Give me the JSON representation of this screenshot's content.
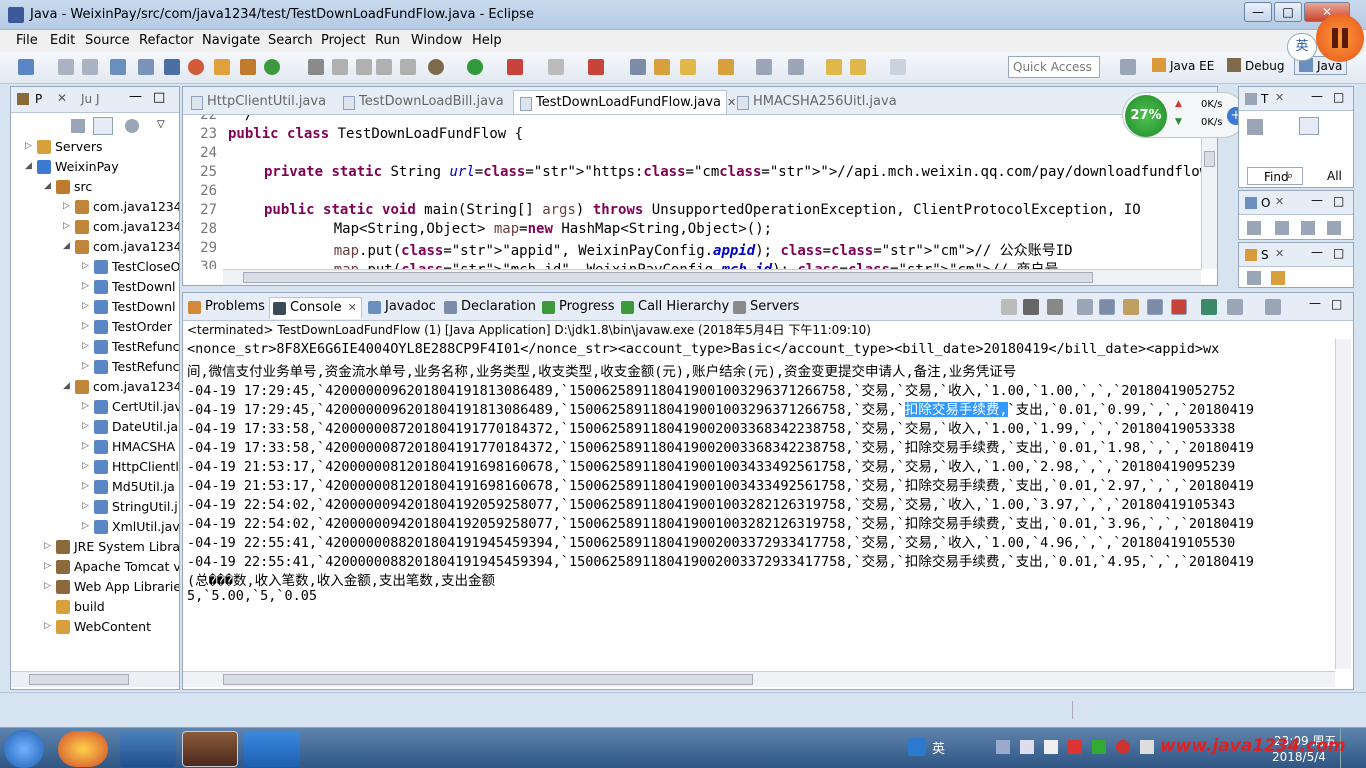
{
  "window": {
    "title": "Java - WeixinPay/src/com/java1234/test/TestDownLoadFundFlow.java - Eclipse",
    "minimize": "—",
    "maximize": "□",
    "close": "✕"
  },
  "menu": [
    "File",
    "Edit",
    "Source",
    "Refactor",
    "Navigate",
    "Search",
    "Project",
    "Run",
    "Window",
    "Help"
  ],
  "toolbar": {
    "quick_access": "Quick Access",
    "perspectives": [
      "Java EE",
      "Debug",
      "Java"
    ]
  },
  "overlay": {
    "ime_label": "英",
    "cpu_percent": "27%",
    "net_up": "0K/s",
    "net_down": "0K/s"
  },
  "explorer": {
    "tabs": [
      "P",
      "Ju J"
    ],
    "tree": [
      {
        "label": "Servers",
        "depth": 0,
        "arrow": "▷",
        "kind": "folder"
      },
      {
        "label": "WeixinPay",
        "depth": 0,
        "arrow": "◢",
        "kind": "project"
      },
      {
        "label": "src",
        "depth": 1,
        "arrow": "◢",
        "kind": "src"
      },
      {
        "label": "com.java1234",
        "depth": 2,
        "arrow": "▷",
        "kind": "pkg"
      },
      {
        "label": "com.java1234",
        "depth": 2,
        "arrow": "▷",
        "kind": "pkg"
      },
      {
        "label": "com.java1234",
        "depth": 2,
        "arrow": "◢",
        "kind": "pkg"
      },
      {
        "label": "TestCloseO",
        "depth": 3,
        "arrow": "▷",
        "kind": "java"
      },
      {
        "label": "TestDownl",
        "depth": 3,
        "arrow": "▷",
        "kind": "java"
      },
      {
        "label": "TestDownl",
        "depth": 3,
        "arrow": "▷",
        "kind": "java"
      },
      {
        "label": "TestOrder",
        "depth": 3,
        "arrow": "▷",
        "kind": "java"
      },
      {
        "label": "TestRefunc",
        "depth": 3,
        "arrow": "▷",
        "kind": "java"
      },
      {
        "label": "TestRefunc",
        "depth": 3,
        "arrow": "▷",
        "kind": "java"
      },
      {
        "label": "com.java1234",
        "depth": 2,
        "arrow": "◢",
        "kind": "pkg"
      },
      {
        "label": "CertUtil.jav",
        "depth": 3,
        "arrow": "▷",
        "kind": "java"
      },
      {
        "label": "DateUtil.ja",
        "depth": 3,
        "arrow": "▷",
        "kind": "java"
      },
      {
        "label": "HMACSHA",
        "depth": 3,
        "arrow": "▷",
        "kind": "java"
      },
      {
        "label": "HttpClientl",
        "depth": 3,
        "arrow": "▷",
        "kind": "java"
      },
      {
        "label": "Md5Util.ja",
        "depth": 3,
        "arrow": "▷",
        "kind": "java"
      },
      {
        "label": "StringUtil.j",
        "depth": 3,
        "arrow": "▷",
        "kind": "java"
      },
      {
        "label": "XmlUtil.jav",
        "depth": 3,
        "arrow": "▷",
        "kind": "java"
      },
      {
        "label": "JRE System Libra",
        "depth": 1,
        "arrow": "▷",
        "kind": "lib"
      },
      {
        "label": "Apache Tomcat v",
        "depth": 1,
        "arrow": "▷",
        "kind": "lib"
      },
      {
        "label": "Web App Librarie",
        "depth": 1,
        "arrow": "▷",
        "kind": "lib"
      },
      {
        "label": "build",
        "depth": 1,
        "arrow": "",
        "kind": "folder"
      },
      {
        "label": "WebContent",
        "depth": 1,
        "arrow": "▷",
        "kind": "folder"
      }
    ]
  },
  "editor": {
    "tabs": [
      {
        "label": "HttpClientUtil.java",
        "active": false
      },
      {
        "label": "TestDownLoadBill.java",
        "active": false
      },
      {
        "label": "TestDownLoadFundFlow.java",
        "active": true
      },
      {
        "label": "HMACSHA256Uitl.java",
        "active": false
      }
    ],
    "lines": [
      {
        "n": "22",
        "text": " */"
      },
      {
        "n": "23",
        "text": "public class TestDownLoadFundFlow {"
      },
      {
        "n": "24",
        "text": ""
      },
      {
        "n": "25",
        "text": "    private static String url=\"https://api.mch.weixin.qq.com/pay/downloadfundflow\";"
      },
      {
        "n": "26",
        "text": ""
      },
      {
        "n": "27",
        "text": "    public static void main(String[] args) throws UnsupportedOperationException, ClientProtocolException, IO"
      },
      {
        "n": "28",
        "text": "        Map<String,Object> map=new HashMap<String,Object>();"
      },
      {
        "n": "29",
        "text": "        map.put(\"appid\", WeixinPayConfig.appid); // 公众账号ID"
      },
      {
        "n": "30",
        "text": "        map.put(\"mch_id\", WeixinPayConfig.mch_id); // 商户号"
      }
    ]
  },
  "right_panels": {
    "outline_tab": "T",
    "find_label": "Find",
    "all_label": "All",
    "panel2_tab": "O",
    "panel3_tab": "S"
  },
  "console": {
    "tabs": [
      {
        "label": "Problems",
        "active": false
      },
      {
        "label": "Console",
        "active": true
      },
      {
        "label": "Javadoc",
        "active": false
      },
      {
        "label": "Declaration",
        "active": false
      },
      {
        "label": "Progress",
        "active": false
      },
      {
        "label": "Call Hierarchy",
        "active": false
      },
      {
        "label": "Servers",
        "active": false
      }
    ],
    "status": "<terminated> TestDownLoadFundFlow (1) [Java Application] D:\\jdk1.8\\bin\\javaw.exe (2018年5月4日 下午11:09:10)",
    "lines": [
      "<nonce_str>8F8XE6G6IE4004OYL8E288CP9F4I01</nonce_str><account_type>Basic</account_type><bill_date>20180419</bill_date><appid>wx",
      "间,微信支付业务单号,资金流水单号,业务名称,业务类型,收支类型,收支金额(元),账户结余(元),资金变更提交申请人,备注,业务凭证号",
      "-04-19 17:29:45,`4200000096201804191813086489,`1500625891180419001003296371266758,`交易,`交易,`收入,`1.00,`1.00,`,`,`20180419052752",
      "-04-19 17:29:45,`4200000096201804191813086489,`1500625891180419001003296371266758,`交易,`扣除交易手续费,`支出,`0.01,`0.99,`,`,`20180419",
      "-04-19 17:33:58,`4200000087201804191770184372,`1500625891180419002003368342238758,`交易,`交易,`收入,`1.00,`1.99,`,`,`20180419053338",
      "-04-19 17:33:58,`4200000087201804191770184372,`1500625891180419002003368342238758,`交易,`扣除交易手续费,`支出,`0.01,`1.98,`,`,`20180419",
      "-04-19 21:53:17,`4200000081201804191698160678,`1500625891180419001003433492561758,`交易,`交易,`收入,`1.00,`2.98,`,`,`20180419095239",
      "-04-19 21:53:17,`4200000081201804191698160678,`1500625891180419001003433492561758,`交易,`扣除交易手续费,`支出,`0.01,`2.97,`,`,`20180419",
      "-04-19 22:54:02,`4200000094201804192059258077,`1500625891180419001003282126319758,`交易,`交易,`收入,`1.00,`3.97,`,`,`20180419105343",
      "-04-19 22:54:02,`4200000094201804192059258077,`1500625891180419001003282126319758,`交易,`扣除交易手续费,`支出,`0.01,`3.96,`,`,`20180419",
      "-04-19 22:55:41,`4200000088201804191945459394,`1500625891180419002003372933417758,`交易,`交易,`收入,`1.00,`4.96,`,`,`20180419105530",
      "-04-19 22:55:41,`4200000088201804191945459394,`1500625891180419002003372933417758,`交易,`扣除交易手续费,`支出,`0.01,`4.95,`,`,`20180419",
      "(总���数,收入笔数,收入金额,支出笔数,支出金额",
      "5,`5.00,`5,`0.05"
    ],
    "highlight": {
      "before": "-04-19 17:29:45,`4200000096201804191813086489,`1500625891180419001003296371266758,`交易,`",
      "selected": "扣除交易手续费,",
      "after": "`支出,`0.01,`0.99,`,`,`20180419"
    }
  },
  "taskbar": {
    "ime": "英",
    "time": "23:09 周五",
    "date": "2018/5/4",
    "watermark": "www.java1234.com"
  },
  "colors": {
    "keyword": "#7f0055",
    "string": "#2a00ff",
    "field": "#0000c0",
    "comment": "#3f7f5f",
    "selection": "#3399ff"
  }
}
